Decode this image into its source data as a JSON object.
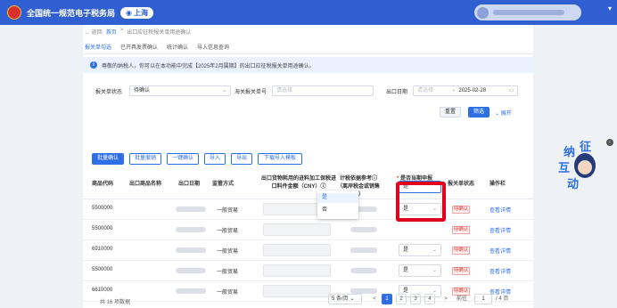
{
  "header": {
    "app_title": "全国统一规范电子税务局",
    "region": "上海",
    "region_icon": "location-pin-icon"
  },
  "breadcrumb": {
    "back": "返回",
    "home": "首页",
    "sep": ">",
    "current": "出口应征税报关单用途确认"
  },
  "tabs": [
    "报关单勾选",
    "已开具发票确认",
    "统计确认",
    "导入信息查询"
  ],
  "notice": {
    "text": "尊敬的纳税人，你可以在本功能中完成【2025年2月属期】的出口应征税报关单用途确认。"
  },
  "filters": {
    "status_label": "报关单状态",
    "status_value": "待确认",
    "customs_no_label": "海关报关单号",
    "customs_no_placeholder": "请选择",
    "export_date_label": "出口日期",
    "date_start_placeholder": "请选择",
    "date_sep": "-",
    "date_end": "2025-02-28",
    "reset": "重置",
    "search": "筛选",
    "expand": "展开"
  },
  "actions": [
    "批量确认",
    "批量撤销",
    "一键确认",
    "导入",
    "导出",
    "下载导入模板"
  ],
  "table": {
    "columns": [
      "商品代码",
      "出口商品名称",
      "出口日期",
      "监管方式",
      "出口货物耗用的进料加工保税进口料件金额（CNY）ⓘ",
      "计税依据参考ⓘ（离岸税金或销售额）",
      "是否当期申报并开票收入",
      "报关单状态",
      "操作栏"
    ],
    "rows": [
      {
        "code": "5500000",
        "method": "一般贸易",
        "choice": "是",
        "status": "待确认",
        "op": "查看详情"
      },
      {
        "code": "5500000",
        "method": "一般贸易",
        "choice": "",
        "status": "待确认",
        "op": "查看详情"
      },
      {
        "code": "6910000",
        "method": "一般贸易",
        "choice": "是",
        "status": "待确认",
        "op": "查看详情"
      },
      {
        "code": "5500000",
        "method": "一般贸易",
        "choice": "是",
        "status": "待确认",
        "op": "查看详情"
      },
      {
        "code": "6610000",
        "method": "一般贸易",
        "choice": "是",
        "status": "待确认",
        "op": "查看详情"
      }
    ],
    "dropdown_options": [
      "是",
      "否"
    ]
  },
  "pagination": {
    "total": "共 16 项数据",
    "page_size": "5 条/页",
    "prev": "<",
    "next": ">",
    "pages": [
      "1",
      "2",
      "3",
      "4"
    ],
    "goto_label": "前往",
    "goto_value": "1",
    "total_pages": "/ 4 页"
  },
  "mascot": {
    "chars": [
      "纳",
      "征",
      "互",
      "动"
    ]
  },
  "side_tab": "‹"
}
